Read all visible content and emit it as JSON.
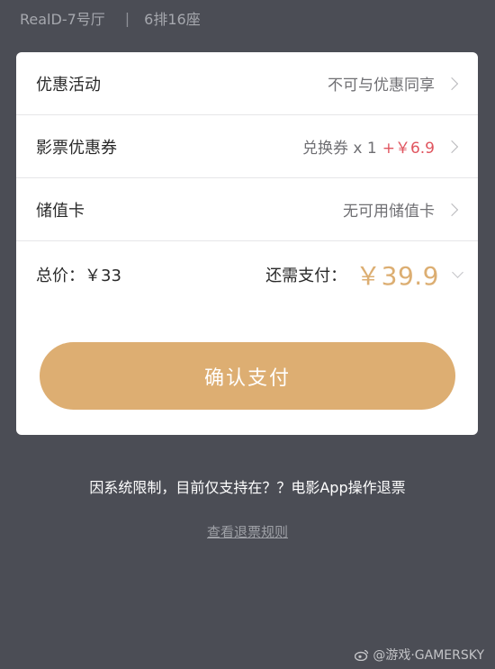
{
  "header": {
    "hall": "RealD-7号厅",
    "separator": "|",
    "seat": "6排16座"
  },
  "rows": [
    {
      "label": "优惠活动",
      "value": "不可与优惠同享"
    },
    {
      "label": "影票优惠券",
      "value": "兑换券 x 1",
      "extra": "+￥6.9"
    },
    {
      "label": "储值卡",
      "value": "无可用储值卡"
    }
  ],
  "total": {
    "label": "总价：￥33",
    "due_label": "还需支付：",
    "due_amount": "￥39.9"
  },
  "confirm_button": "确认支付",
  "notice": "因系统限制，目前仅支持在？？电影App操作退票",
  "rules_link": "查看退票规则",
  "watermark": "@游戏·GAMERSKY",
  "colors": {
    "background": "#4b4d55",
    "card": "#ffffff",
    "accent": "#ddae72",
    "red": "#e0555f"
  }
}
